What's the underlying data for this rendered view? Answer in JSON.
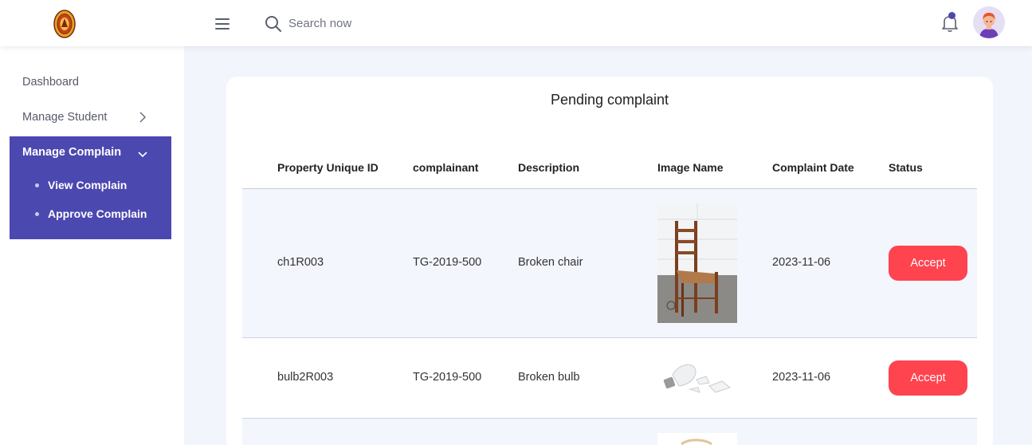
{
  "header": {
    "search_placeholder": "Search now"
  },
  "sidebar": {
    "items": [
      {
        "label": "Dashboard"
      },
      {
        "label": "Manage Student"
      },
      {
        "label": "Manage Complain"
      }
    ],
    "subitems": [
      {
        "label": "View Complain"
      },
      {
        "label": "Approve Complain"
      }
    ]
  },
  "main": {
    "title": "Pending complaint",
    "columns": [
      "Property Unique ID",
      "complainant",
      "Description",
      "Image Name",
      "Complaint Date",
      "Status"
    ],
    "rows": [
      {
        "id": "ch1R003",
        "complainant": "TG-2019-500",
        "description": "Broken chair",
        "image": "chair-photo",
        "date": "2023-11-06",
        "status": "Accept"
      },
      {
        "id": "bulb2R003",
        "complainant": "TG-2019-500",
        "description": "Broken bulb",
        "image": "broken-bulb-photo",
        "date": "2023-11-06",
        "status": "Accept"
      }
    ],
    "accept_label": "Accept"
  },
  "colors": {
    "accent": "#4b48b0",
    "accept_button": "#ff434f",
    "page_bg": "#f3f5fc"
  }
}
